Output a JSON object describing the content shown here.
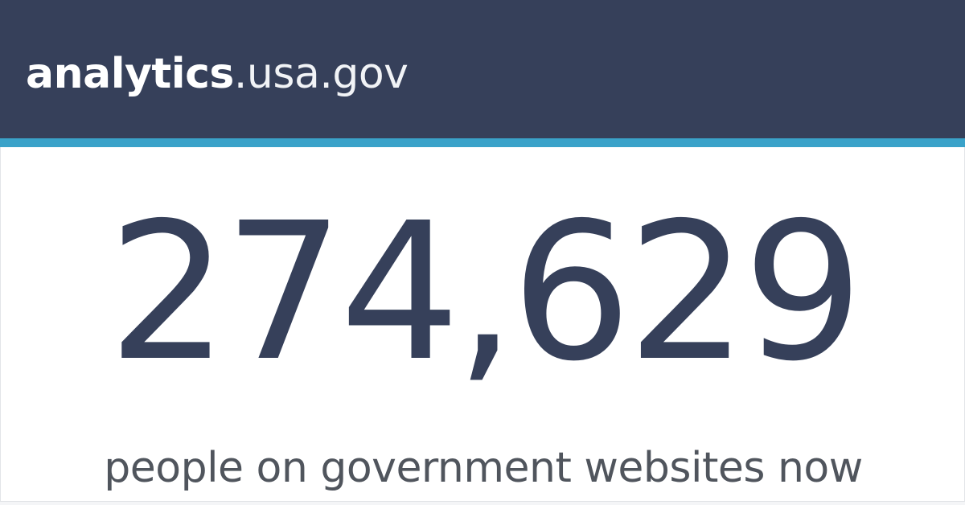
{
  "site": {
    "logo_bold": "analytics",
    "logo_light": ".usa.gov"
  },
  "realtime": {
    "count": "274,629",
    "caption": "people on government websites now"
  },
  "colors": {
    "header_bg": "#36405a",
    "accent_stripe": "#3aa2c9",
    "count_text": "#36405a",
    "caption_text": "#50555d"
  }
}
